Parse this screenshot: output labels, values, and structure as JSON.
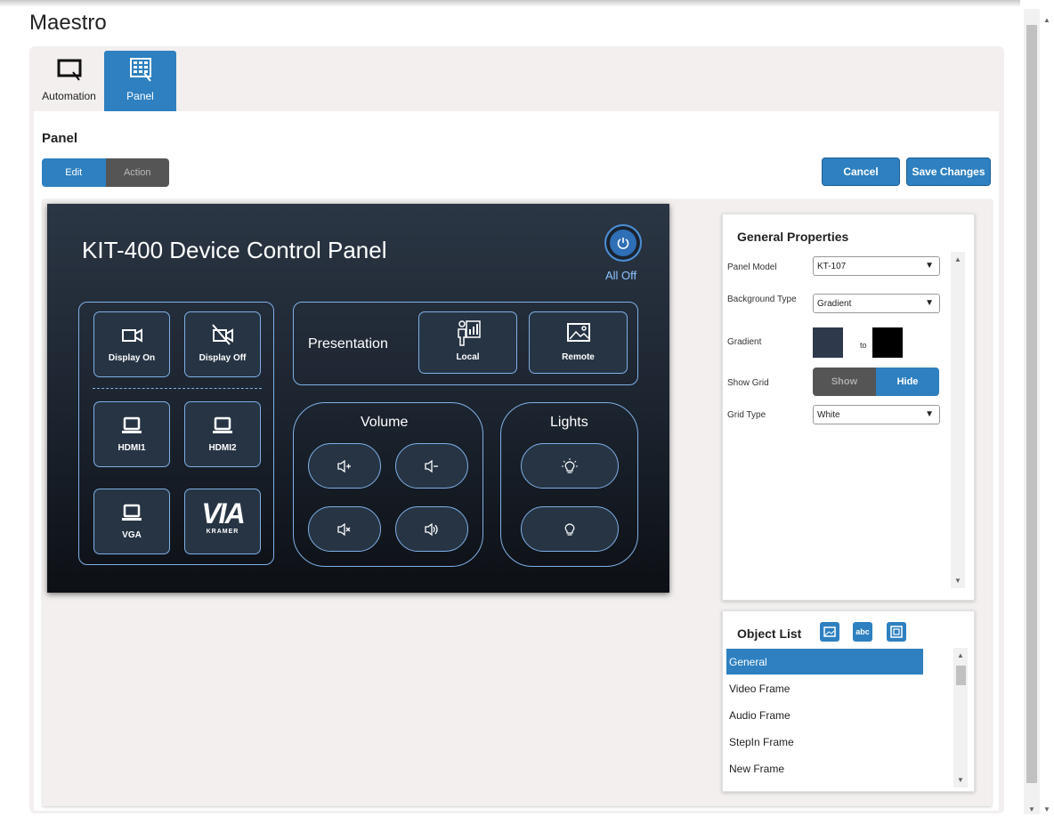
{
  "app": {
    "title": "Maestro"
  },
  "tabs": [
    {
      "label": "Automation",
      "icon": "monitor-pointer-icon"
    },
    {
      "label": "Panel",
      "icon": "grid-panel-icon"
    }
  ],
  "panel": {
    "heading": "Panel",
    "mode": {
      "edit": "Edit",
      "action": "Action",
      "selected": "Edit"
    },
    "cancel_label": "Cancel",
    "save_label": "Save Changes"
  },
  "device": {
    "title": "KIT-400 Device Control Panel",
    "all_off": "All Off",
    "display_on": "Display On",
    "display_off": "Display Off",
    "hdmi1": "HDMI1",
    "hdmi2": "HDMI2",
    "vga": "VGA",
    "via_logo": "VIA",
    "via_sub": "KRAMER",
    "presentation": "Presentation",
    "local": "Local",
    "remote": "Remote",
    "volume": "Volume",
    "lights": "Lights"
  },
  "general_properties": {
    "title": "General Properties",
    "panel_model_label": "Panel Model",
    "panel_model_value": "KT-107",
    "background_type_label": "Background Type",
    "background_type_value": "Gradient",
    "gradient_label": "Gradient",
    "gradient_to": "to",
    "gradient_from_color": "#2e3a4c",
    "gradient_to_color": "#000000",
    "show_grid_label": "Show Grid",
    "show_grid_show": "Show",
    "show_grid_hide": "Hide",
    "show_grid_selected": "Hide",
    "grid_type_label": "Grid Type",
    "grid_type_value": "White"
  },
  "object_list": {
    "title": "Object List",
    "items": [
      "General",
      "Video Frame",
      "Audio Frame",
      "StepIn Frame",
      "New Frame"
    ],
    "selected": "General"
  },
  "colors": {
    "accent": "#2e80c0",
    "panel_bg": "#1b232e",
    "frame": "#7fb0e6"
  }
}
